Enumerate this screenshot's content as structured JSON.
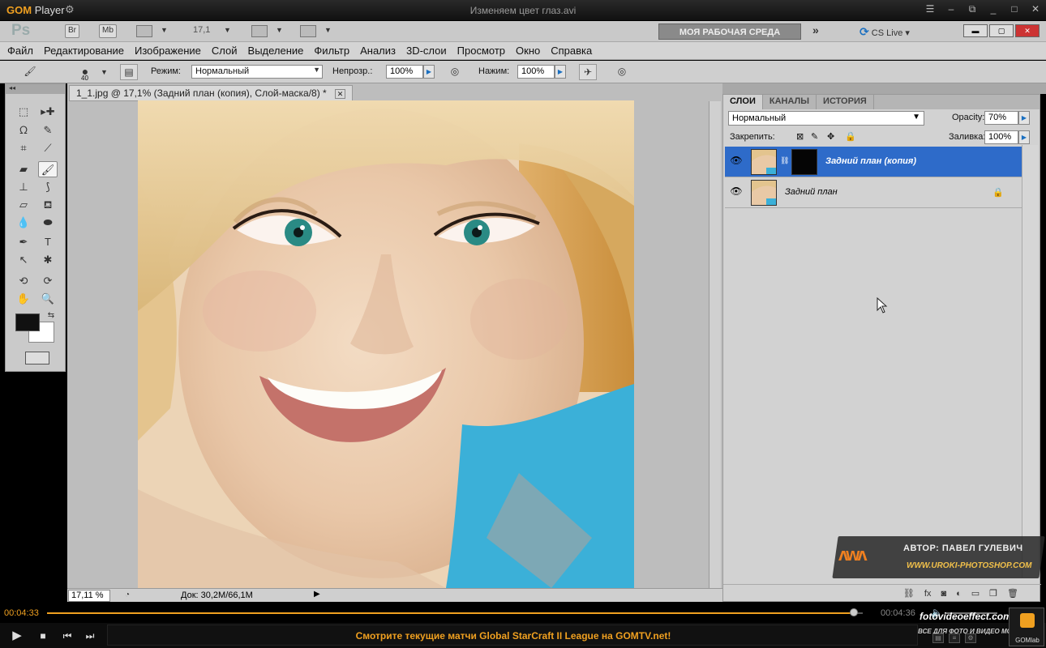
{
  "gom": {
    "logo_brand": "GOM",
    "logo_suffix": "Player",
    "file_title": "Изменяем цвет глаз.avi",
    "time_current": "00:04:33",
    "time_total": "00:04:36",
    "ticker": "Смотрите текущие матчи Global StarCraft II League на GOMTV.net!",
    "badge_label": "GOMlab",
    "progress": 0.989
  },
  "ps": {
    "logo": "Ps",
    "br_label": "Br",
    "mb_label": "Mb",
    "zoom_level": "17,1",
    "workspace": "МОЯ РАБОЧАЯ СРЕДА",
    "cs_live": "CS Live"
  },
  "menu": [
    "Файл",
    "Редактирование",
    "Изображение",
    "Слой",
    "Выделение",
    "Фильтр",
    "Анализ",
    "3D-слои",
    "Просмотр",
    "Окно",
    "Справка"
  ],
  "options": {
    "brush_size": "40",
    "mode_label": "Режим:",
    "mode_value": "Нормальный",
    "opacity_label": "Непрозр.:",
    "opacity_value": "100%",
    "flow_label": "Нажим:",
    "flow_value": "100%"
  },
  "document": {
    "tab_title": "1_1.jpg @ 17,1% (Задний план (копия), Слой-маска/8) *",
    "zoom": "17,11 %",
    "doc_info": "Док: 30,2M/66,1M"
  },
  "layers_panel": {
    "tabs": [
      "СЛОИ",
      "КАНАЛЫ",
      "ИСТОРИЯ"
    ],
    "blend_mode": "Нормальный",
    "opacity_label": "Opacity:",
    "opacity_value": "70%",
    "lock_label": "Закрепить:",
    "fill_label": "Заливка:",
    "fill_value": "100%",
    "layers": [
      {
        "name": "Задний план (копия)",
        "selected": true
      },
      {
        "name": "Задний план",
        "selected": false
      }
    ]
  },
  "watermark": {
    "author": "АВТОР: ПАВЕЛ ГУЛЕВИЧ",
    "site": "WWW.UROKI-PHOTOSHOP.COM",
    "brand": "fotovideoeffect.com",
    "tagline": "ВСЕ ДЛЯ ФОТО И ВИДЕО МОНТАЖА!"
  },
  "colors": {
    "gom_accent": "#f0a020",
    "selection": "#2e6bc9",
    "ps_panel": "#d2d2d2"
  }
}
